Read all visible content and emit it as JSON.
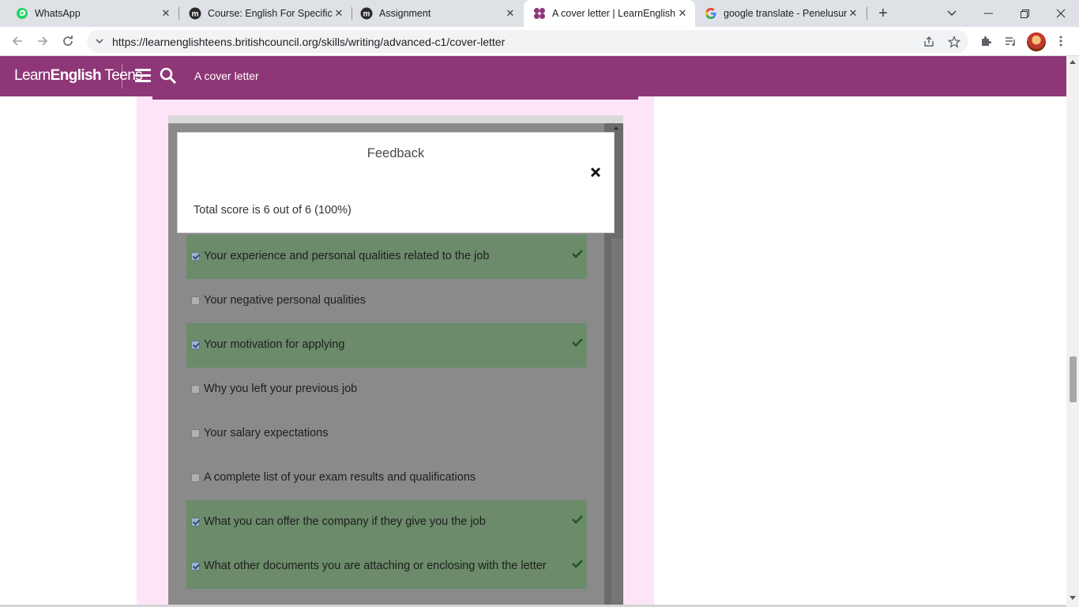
{
  "browser": {
    "tabs": [
      {
        "title": "WhatsApp",
        "favicon": "whatsapp-icon",
        "active": false
      },
      {
        "title": "Course: English For Specific P",
        "favicon": "moodle-icon",
        "active": false
      },
      {
        "title": "Assignment",
        "favicon": "moodle-icon",
        "active": false
      },
      {
        "title": "A cover letter | LearnEnglish",
        "favicon": "learnenglish-icon",
        "active": true
      },
      {
        "title": "google translate - Penelusura",
        "favicon": "google-icon",
        "active": false
      }
    ],
    "url": "https://learnenglishteens.britishcouncil.org/skills/writing/advanced-c1/cover-letter"
  },
  "header": {
    "logo_light": "Learn",
    "logo_bold": "English",
    "logo_suffix": " Teens",
    "title": "A cover letter",
    "brand_color": "#8e3677"
  },
  "modal": {
    "title": "Feedback",
    "score_text": "Total score is 6 out of 6 (100%)"
  },
  "options": [
    {
      "label": "Your experience and personal qualities related to the job",
      "checked": true,
      "correct": true
    },
    {
      "label": "Your negative personal qualities",
      "checked": false,
      "correct": false
    },
    {
      "label": "Your motivation for applying",
      "checked": true,
      "correct": true
    },
    {
      "label": "Why you left your previous job",
      "checked": false,
      "correct": false
    },
    {
      "label": "Your salary expectations",
      "checked": false,
      "correct": false
    },
    {
      "label": "A complete list of your exam results and qualifications",
      "checked": false,
      "correct": false
    },
    {
      "label": "What you can offer the company if they give you the job",
      "checked": true,
      "correct": true
    },
    {
      "label": "What other documents you are attaching or enclosing with the letter",
      "checked": true,
      "correct": true
    }
  ],
  "colors": {
    "correct_bg": "#6b8b6b",
    "tick": "#1e5a1e"
  }
}
